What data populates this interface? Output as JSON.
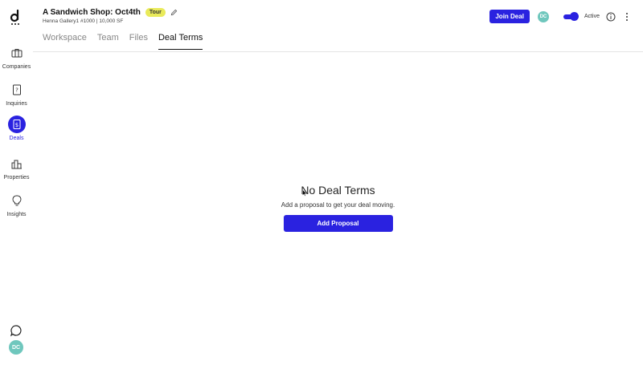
{
  "sidebar": {
    "items": [
      {
        "label": "Companies",
        "icon": "briefcase-icon"
      },
      {
        "label": "Inquiries",
        "icon": "inquiry-icon"
      },
      {
        "label": "Deals",
        "icon": "deals-icon"
      },
      {
        "label": "Properties",
        "icon": "buildings-icon"
      },
      {
        "label": "Insights",
        "icon": "lightbulb-icon"
      }
    ],
    "active_item": "Deals",
    "avatar_initials": "DC"
  },
  "header": {
    "title": "A Sandwich Shop: Oct4th",
    "badge": "Tour",
    "subtitle": "Henna Gallery1 #1000 | 10,000 SF",
    "tabs": [
      {
        "label": "Workspace"
      },
      {
        "label": "Team"
      },
      {
        "label": "Files"
      },
      {
        "label": "Deal Terms"
      }
    ],
    "active_tab": "Deal Terms",
    "join_label": "Join Deal",
    "avatar_initials": "DC",
    "status_label": "Active",
    "toggle_on": true
  },
  "main": {
    "empty_title": "No Deal Terms",
    "empty_subtitle": "Add a proposal to get your deal moving.",
    "add_button_label": "Add Proposal"
  },
  "colors": {
    "accent": "#2a22e0",
    "badge": "#e9ea5a",
    "avatar": "#6fc7bd"
  }
}
